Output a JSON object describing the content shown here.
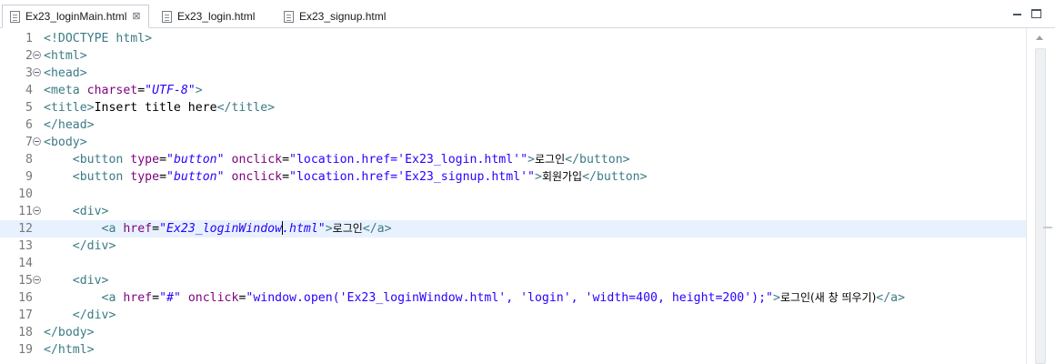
{
  "tabs": [
    {
      "label": "Ex23_loginMain.html",
      "active": true,
      "close_label": "⊠"
    },
    {
      "label": "Ex23_login.html",
      "active": false
    },
    {
      "label": "Ex23_signup.html",
      "active": false
    }
  ],
  "window_controls": {
    "minimize_icon": "minimize-icon",
    "maximize_icon": "maximize-icon"
  },
  "colors": {
    "tag": "#3c7b85",
    "attr": "#7f007f",
    "value": "#2a00ff",
    "current_line": "#e8f2fe"
  },
  "editor": {
    "current_line": 12,
    "lines": [
      {
        "n": "1",
        "fold": false,
        "tokens": [
          [
            "tag",
            "<!DOCTYPE html>"
          ]
        ]
      },
      {
        "n": "2",
        "fold": true,
        "tokens": [
          [
            "tag",
            "<html>"
          ]
        ]
      },
      {
        "n": "3",
        "fold": true,
        "tokens": [
          [
            "tag",
            "<head>"
          ]
        ]
      },
      {
        "n": "4",
        "fold": false,
        "tokens": [
          [
            "tag",
            "<meta "
          ],
          [
            "attr",
            "charset"
          ],
          [
            "punc",
            "="
          ],
          [
            "val",
            "\"UTF-8\""
          ],
          [
            "tag",
            ">"
          ]
        ]
      },
      {
        "n": "5",
        "fold": false,
        "tokens": [
          [
            "tag",
            "<title>"
          ],
          [
            "text",
            "Insert title here"
          ],
          [
            "tag",
            "</title>"
          ]
        ]
      },
      {
        "n": "6",
        "fold": false,
        "tokens": [
          [
            "tag",
            "</head>"
          ]
        ]
      },
      {
        "n": "7",
        "fold": true,
        "tokens": [
          [
            "tag",
            "<body>"
          ]
        ]
      },
      {
        "n": "8",
        "fold": false,
        "tokens": [
          [
            "text",
            "    "
          ],
          [
            "tag",
            "<button "
          ],
          [
            "attr",
            "type"
          ],
          [
            "punc",
            "="
          ],
          [
            "val",
            "\"button\""
          ],
          [
            "text",
            " "
          ],
          [
            "attr",
            "onclick"
          ],
          [
            "punc",
            "="
          ],
          [
            "str",
            "\"location.href='Ex23_login.html'\""
          ],
          [
            "tag",
            ">"
          ],
          [
            "kr",
            "로그인"
          ],
          [
            "tag",
            "</button>"
          ]
        ]
      },
      {
        "n": "9",
        "fold": false,
        "tokens": [
          [
            "text",
            "    "
          ],
          [
            "tag",
            "<button "
          ],
          [
            "attr",
            "type"
          ],
          [
            "punc",
            "="
          ],
          [
            "val",
            "\"button\""
          ],
          [
            "text",
            " "
          ],
          [
            "attr",
            "onclick"
          ],
          [
            "punc",
            "="
          ],
          [
            "str",
            "\"location.href='Ex23_signup.html'\""
          ],
          [
            "tag",
            ">"
          ],
          [
            "kr",
            "회원가입"
          ],
          [
            "tag",
            "</button>"
          ]
        ]
      },
      {
        "n": "10",
        "fold": false,
        "tokens": []
      },
      {
        "n": "11",
        "fold": true,
        "tokens": [
          [
            "text",
            "    "
          ],
          [
            "tag",
            "<div>"
          ]
        ]
      },
      {
        "n": "12",
        "fold": false,
        "tokens": [
          [
            "text",
            "        "
          ],
          [
            "tag",
            "<a "
          ],
          [
            "attr",
            "href"
          ],
          [
            "punc",
            "="
          ],
          [
            "val",
            "\"Ex23_loginWindow"
          ],
          [
            "caret",
            ""
          ],
          [
            "val",
            ".html\""
          ],
          [
            "tag",
            ">"
          ],
          [
            "kr",
            "로그인"
          ],
          [
            "tag",
            "</a>"
          ]
        ]
      },
      {
        "n": "13",
        "fold": false,
        "tokens": [
          [
            "text",
            "    "
          ],
          [
            "tag",
            "</div>"
          ]
        ]
      },
      {
        "n": "14",
        "fold": false,
        "tokens": []
      },
      {
        "n": "15",
        "fold": true,
        "tokens": [
          [
            "text",
            "    "
          ],
          [
            "tag",
            "<div>"
          ]
        ]
      },
      {
        "n": "16",
        "fold": false,
        "tokens": [
          [
            "text",
            "        "
          ],
          [
            "tag",
            "<a "
          ],
          [
            "attr",
            "href"
          ],
          [
            "punc",
            "="
          ],
          [
            "str",
            "\"#\""
          ],
          [
            "text",
            " "
          ],
          [
            "attr",
            "onclick"
          ],
          [
            "punc",
            "="
          ],
          [
            "str",
            "\"window.open('Ex23_loginWindow.html', 'login', 'width=400, height=200');\""
          ],
          [
            "tag",
            ">"
          ],
          [
            "kr",
            "로그인(새 창 띄우기)"
          ],
          [
            "tag",
            "</a>"
          ]
        ]
      },
      {
        "n": "17",
        "fold": false,
        "tokens": [
          [
            "text",
            "    "
          ],
          [
            "tag",
            "</div>"
          ]
        ]
      },
      {
        "n": "18",
        "fold": false,
        "tokens": [
          [
            "tag",
            "</body>"
          ]
        ]
      },
      {
        "n": "19",
        "fold": false,
        "tokens": [
          [
            "tag",
            "</html>"
          ]
        ]
      }
    ]
  }
}
